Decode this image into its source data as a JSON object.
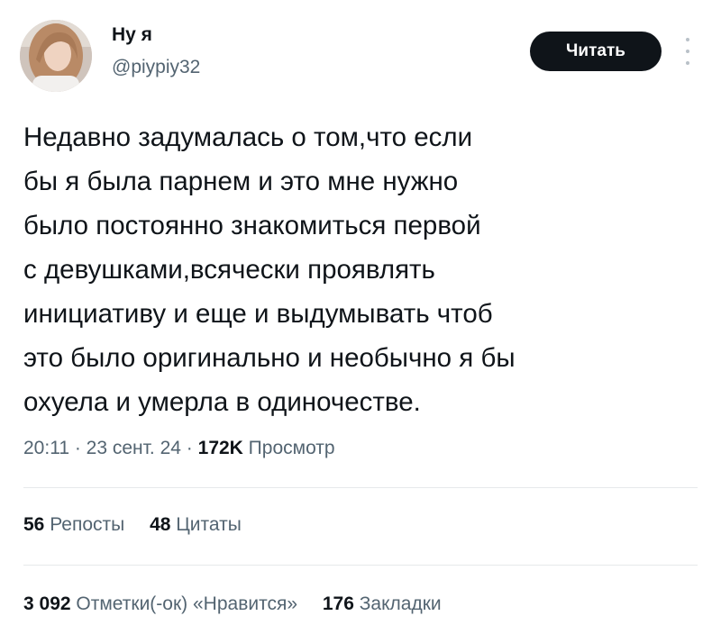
{
  "author": {
    "name": "Ну я",
    "handle": "@piypiy32",
    "follow_label": "Читать",
    "more_icon": "more-dots-icon"
  },
  "tweet": {
    "lines": [
      "Недавно задумалась о том,что если",
      "бы я была парнем и это мне нужно",
      "было постоянно знакомиться первой",
      "с девушками,всячески проявлять",
      "инициативу и еще и выдумывать чтоб",
      "это было оригинально и необычно я бы",
      "охуела и умерла в одиночестве."
    ]
  },
  "meta": {
    "time": "20:11",
    "sep1": " · ",
    "date": "23 сент. 24",
    "sep2": " · ",
    "views": "172K",
    "views_label": " Просмотр"
  },
  "stats": {
    "reposts_count": "56",
    "reposts_label": " Репосты",
    "quotes_count": "48",
    "quotes_label": " Цитаты",
    "likes_count": "3 092",
    "likes_label": " Отметки(-ок) «Нравится»",
    "bookmarks_count": "176",
    "bookmarks_label": " Закладки"
  },
  "colors": {
    "text": "#0f1419",
    "secondary": "#536471",
    "button_bg": "#0f1419",
    "divider": "#e6e9eb"
  }
}
